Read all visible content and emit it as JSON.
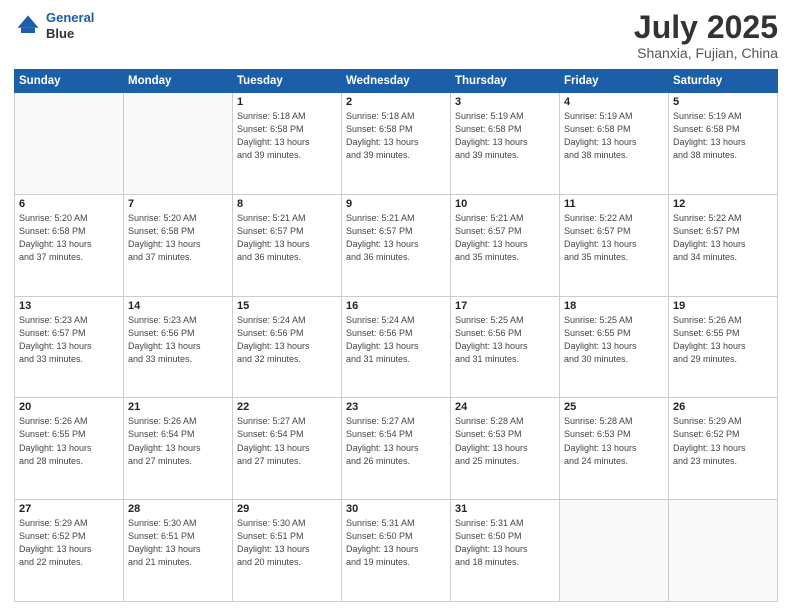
{
  "header": {
    "logo_line1": "General",
    "logo_line2": "Blue",
    "main_title": "July 2025",
    "subtitle": "Shanxia, Fujian, China"
  },
  "days_of_week": [
    "Sunday",
    "Monday",
    "Tuesday",
    "Wednesday",
    "Thursday",
    "Friday",
    "Saturday"
  ],
  "weeks": [
    [
      {
        "day": "",
        "info": ""
      },
      {
        "day": "",
        "info": ""
      },
      {
        "day": "1",
        "info": "Sunrise: 5:18 AM\nSunset: 6:58 PM\nDaylight: 13 hours\nand 39 minutes."
      },
      {
        "day": "2",
        "info": "Sunrise: 5:18 AM\nSunset: 6:58 PM\nDaylight: 13 hours\nand 39 minutes."
      },
      {
        "day": "3",
        "info": "Sunrise: 5:19 AM\nSunset: 6:58 PM\nDaylight: 13 hours\nand 39 minutes."
      },
      {
        "day": "4",
        "info": "Sunrise: 5:19 AM\nSunset: 6:58 PM\nDaylight: 13 hours\nand 38 minutes."
      },
      {
        "day": "5",
        "info": "Sunrise: 5:19 AM\nSunset: 6:58 PM\nDaylight: 13 hours\nand 38 minutes."
      }
    ],
    [
      {
        "day": "6",
        "info": "Sunrise: 5:20 AM\nSunset: 6:58 PM\nDaylight: 13 hours\nand 37 minutes."
      },
      {
        "day": "7",
        "info": "Sunrise: 5:20 AM\nSunset: 6:58 PM\nDaylight: 13 hours\nand 37 minutes."
      },
      {
        "day": "8",
        "info": "Sunrise: 5:21 AM\nSunset: 6:57 PM\nDaylight: 13 hours\nand 36 minutes."
      },
      {
        "day": "9",
        "info": "Sunrise: 5:21 AM\nSunset: 6:57 PM\nDaylight: 13 hours\nand 36 minutes."
      },
      {
        "day": "10",
        "info": "Sunrise: 5:21 AM\nSunset: 6:57 PM\nDaylight: 13 hours\nand 35 minutes."
      },
      {
        "day": "11",
        "info": "Sunrise: 5:22 AM\nSunset: 6:57 PM\nDaylight: 13 hours\nand 35 minutes."
      },
      {
        "day": "12",
        "info": "Sunrise: 5:22 AM\nSunset: 6:57 PM\nDaylight: 13 hours\nand 34 minutes."
      }
    ],
    [
      {
        "day": "13",
        "info": "Sunrise: 5:23 AM\nSunset: 6:57 PM\nDaylight: 13 hours\nand 33 minutes."
      },
      {
        "day": "14",
        "info": "Sunrise: 5:23 AM\nSunset: 6:56 PM\nDaylight: 13 hours\nand 33 minutes."
      },
      {
        "day": "15",
        "info": "Sunrise: 5:24 AM\nSunset: 6:56 PM\nDaylight: 13 hours\nand 32 minutes."
      },
      {
        "day": "16",
        "info": "Sunrise: 5:24 AM\nSunset: 6:56 PM\nDaylight: 13 hours\nand 31 minutes."
      },
      {
        "day": "17",
        "info": "Sunrise: 5:25 AM\nSunset: 6:56 PM\nDaylight: 13 hours\nand 31 minutes."
      },
      {
        "day": "18",
        "info": "Sunrise: 5:25 AM\nSunset: 6:55 PM\nDaylight: 13 hours\nand 30 minutes."
      },
      {
        "day": "19",
        "info": "Sunrise: 5:26 AM\nSunset: 6:55 PM\nDaylight: 13 hours\nand 29 minutes."
      }
    ],
    [
      {
        "day": "20",
        "info": "Sunrise: 5:26 AM\nSunset: 6:55 PM\nDaylight: 13 hours\nand 28 minutes."
      },
      {
        "day": "21",
        "info": "Sunrise: 5:26 AM\nSunset: 6:54 PM\nDaylight: 13 hours\nand 27 minutes."
      },
      {
        "day": "22",
        "info": "Sunrise: 5:27 AM\nSunset: 6:54 PM\nDaylight: 13 hours\nand 27 minutes."
      },
      {
        "day": "23",
        "info": "Sunrise: 5:27 AM\nSunset: 6:54 PM\nDaylight: 13 hours\nand 26 minutes."
      },
      {
        "day": "24",
        "info": "Sunrise: 5:28 AM\nSunset: 6:53 PM\nDaylight: 13 hours\nand 25 minutes."
      },
      {
        "day": "25",
        "info": "Sunrise: 5:28 AM\nSunset: 6:53 PM\nDaylight: 13 hours\nand 24 minutes."
      },
      {
        "day": "26",
        "info": "Sunrise: 5:29 AM\nSunset: 6:52 PM\nDaylight: 13 hours\nand 23 minutes."
      }
    ],
    [
      {
        "day": "27",
        "info": "Sunrise: 5:29 AM\nSunset: 6:52 PM\nDaylight: 13 hours\nand 22 minutes."
      },
      {
        "day": "28",
        "info": "Sunrise: 5:30 AM\nSunset: 6:51 PM\nDaylight: 13 hours\nand 21 minutes."
      },
      {
        "day": "29",
        "info": "Sunrise: 5:30 AM\nSunset: 6:51 PM\nDaylight: 13 hours\nand 20 minutes."
      },
      {
        "day": "30",
        "info": "Sunrise: 5:31 AM\nSunset: 6:50 PM\nDaylight: 13 hours\nand 19 minutes."
      },
      {
        "day": "31",
        "info": "Sunrise: 5:31 AM\nSunset: 6:50 PM\nDaylight: 13 hours\nand 18 minutes."
      },
      {
        "day": "",
        "info": ""
      },
      {
        "day": "",
        "info": ""
      }
    ]
  ]
}
